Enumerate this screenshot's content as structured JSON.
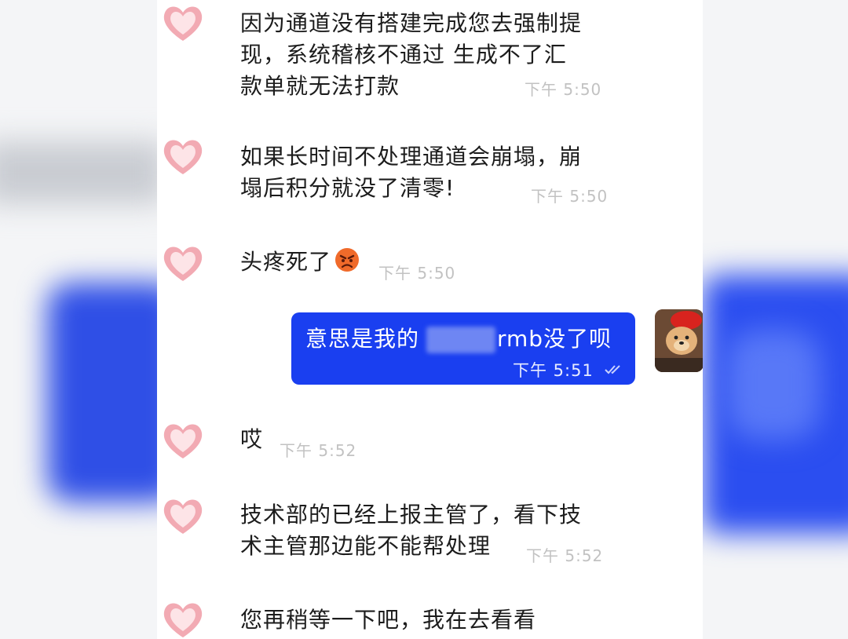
{
  "messages": [
    {
      "lines": [
        "因为通道没有搭建完成您去强制提",
        "现，系统稽核不通过 生成不了汇",
        "款单就无法打款"
      ],
      "time": "下午 5:50"
    },
    {
      "lines": [
        "如果长时间不处理通道会崩塌，崩",
        "塌后积分就没了清零!"
      ],
      "time": "下午 5:50"
    },
    {
      "lines": [
        "头疼死了"
      ],
      "emoji": "angry-face-emoji",
      "time": "下午 5:50"
    },
    {
      "lines": [
        "哎"
      ],
      "time": "下午 5:52"
    },
    {
      "lines": [
        "技术部的已经上报主管了，看下技",
        "术主管那边能不能帮处理"
      ],
      "time": "下午 5:52"
    },
    {
      "lines": [
        "您再稍等一下吧，我在去看看"
      ]
    }
  ],
  "outgoing": {
    "text_before": "意思是我的",
    "text_after": "rmb没了呗",
    "time": "下午 5:51",
    "status_icon": "double-check-icon"
  },
  "avatar_icon": "pink-heart-avatar-icon",
  "colors": {
    "bubble": "#1a3ff0",
    "time_gray": "#c2c2c2"
  }
}
